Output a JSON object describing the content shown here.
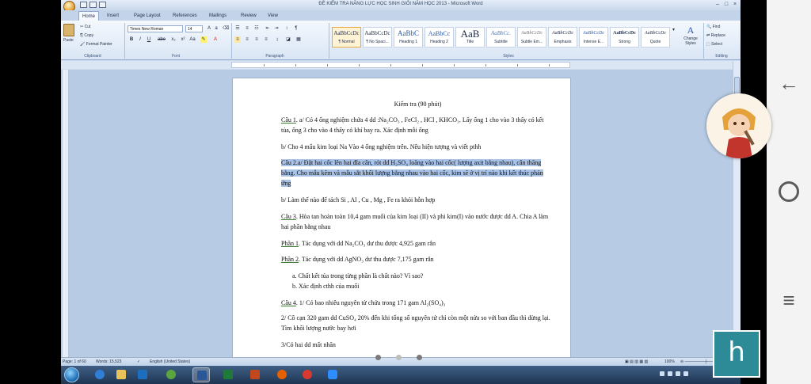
{
  "window": {
    "title": "ĐỀ KIỂM TRA NĂNG LỰC HỌC SINH GIỎI NĂM HỌC 2013 - Microsoft Word"
  },
  "ribbon_tabs": [
    "Home",
    "Insert",
    "Page Layout",
    "References",
    "Mailings",
    "Review",
    "View"
  ],
  "clipboard": {
    "paste": "Paste",
    "cut": "Cut",
    "copy": "Copy",
    "format_painter": "Format Painter",
    "group_label": "Clipboard"
  },
  "font": {
    "family": "Times New Roman",
    "size": "14",
    "group_label": "Font",
    "buttons": [
      "B",
      "I",
      "U",
      "abe",
      "x₂",
      "x²",
      "Aa"
    ]
  },
  "paragraph": {
    "group_label": "Paragraph"
  },
  "styles": {
    "group_label": "Styles",
    "items": [
      {
        "sample": "AaBbCcDc",
        "name": "¶ Normal"
      },
      {
        "sample": "AaBbCcDc",
        "name": "¶ No Spaci..."
      },
      {
        "sample": "AaBbC",
        "name": "Heading 1"
      },
      {
        "sample": "AaBbCc",
        "name": "Heading 2"
      },
      {
        "sample": "AaB",
        "name": "Title"
      },
      {
        "sample": "AaBbCc.",
        "name": "Subtitle"
      },
      {
        "sample": "AaBbCcDc",
        "name": "Subtle Em..."
      },
      {
        "sample": "AaBbCcDc",
        "name": "Emphasis"
      },
      {
        "sample": "AaBbCcDc",
        "name": "Intense E..."
      },
      {
        "sample": "AaBbCcDc",
        "name": "Strong"
      },
      {
        "sample": "AaBbCcDc",
        "name": "Quote"
      }
    ],
    "change_styles": "Change Styles"
  },
  "editing": {
    "find": "Find",
    "replace": "Replace",
    "select": "Select",
    "group_label": "Editing"
  },
  "document": {
    "title": "Kiểm tra (90 phút)",
    "q1a_head": "Câu 1",
    "q1a_body": ". a/ Có 4 ống nghiệm chứa 4 dd :Na₂CO₃ , FeCl₂ , HCl , KHCO₃. Lấy ống 1 cho vào 3 thấy có kết tủa, ống 3 cho vào 4 thấy có khí bay ra. Xác định mỗi ống",
    "q1b": "b/ Cho 4 mẩu kim loại Na Vào 4 ống nghiệm trên. Nêu hiện tượng và viết pthh",
    "q2a": "Câu 2.a/ Đặt hai cốc lên hai đĩa cân, rót dd H₂SO₄ loãng vào hai cốc( lượng axit bằng nhau), cân thăng bằng. Cho mẫu  kẽm  và mẫu sắt  khối lượng bằng nhau vào hai cốc, kim sẽ ở vị trí nào khi kết thúc phản ứng",
    "q2b": "b/ Làm thế nào để tách Si , Al , Cu , Mg , Fe ra khỏi hỗn hợp",
    "q3_head": "Câu 3",
    "q3_body": ". Hòa tan hoàn toàn 10,4 gam muối của kim loại (II) và phi kim(I) vào nước được dd A. Chia A làm hai phần bằng nhau",
    "part1_head": "Phần 1",
    "part1_body": ". Tác dụng với dd Na₂CO₃ dư thu được 4,925 gam rắn",
    "part2_head": "Phần 2",
    "part2_body": ". Tác dụng với dd AgNO₃ dư thu được 7,175 gam rắn",
    "q3_a": "a.   Chất kết tủa trong từng phần là chất nào? Vì sao?",
    "q3_b": "b.   Xác định cthh của muối",
    "q4_head": "Câu 4",
    "q4_body": ". 1/ Có bao nhiêu nguyên tử chứa trong 171 gam Al₂(SO₄)₃",
    "q4_2": "2/ Cô cạn 320 gam dd CuSO₄ 20% đến khi tổng số nguyên tử chỉ còn một nửa so với ban đầu thì dừng lại. Tìm khối lượng nước bay hơi",
    "q4_3": "3/Có hai dd mất nhãn"
  },
  "status": {
    "page": "Page: 1 of 60",
    "words": "Words: 15,523",
    "language": "English (United States)",
    "zoom": "100%"
  },
  "overlay": {
    "h_button": "h"
  },
  "colors": {
    "selection": "#a9c3e8",
    "ribbon": "#dae6f5",
    "h_button": "#2c8b96"
  }
}
